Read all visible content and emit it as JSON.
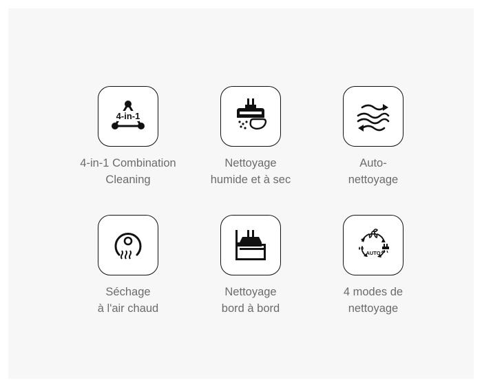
{
  "features": [
    {
      "icon": "triangle-4-in-1-icon",
      "icon_text": "4-in-1",
      "line1": "4-in-1 Combination",
      "line2": "Cleaning"
    },
    {
      "icon": "wet-dry-vacuum-head-icon",
      "line1": "Nettoyage",
      "line2": "humide et à sec"
    },
    {
      "icon": "self-cleaning-wave-arrows-icon",
      "line1": "Auto-",
      "line2": "nettoyage"
    },
    {
      "icon": "hot-air-drying-icon",
      "line1": "Séchage",
      "line2": "à l'air chaud"
    },
    {
      "icon": "edge-to-edge-cleaning-icon",
      "line1": "Nettoyage",
      "line2": "bord à bord"
    },
    {
      "icon": "four-modes-cycle-icon",
      "icon_text": "AUTO",
      "line1": "4 modes de",
      "line2": "nettoyage"
    }
  ]
}
